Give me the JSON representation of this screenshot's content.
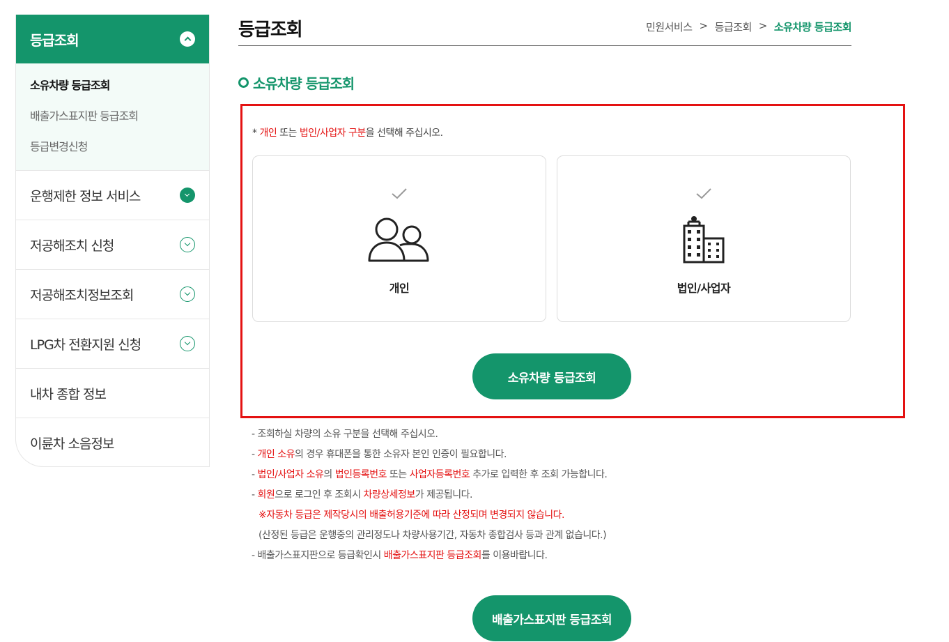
{
  "sidebar": {
    "header": "등급조회",
    "subitems": [
      "소유차량 등급조회",
      "배출가스표지판 등급조회",
      "등급변경신청"
    ],
    "items": [
      "운행제한 정보 서비스",
      "저공해조치 신청",
      "저공해조치정보조회",
      "LPG차 전환지원 신청",
      "내차 종합 정보",
      "이륜차 소음정보"
    ]
  },
  "page": {
    "title": "등급조회",
    "breadcrumb": [
      "민원서비스",
      ">",
      "등급조회",
      ">",
      "소유차량 등급조회"
    ]
  },
  "section": {
    "title": "소유차량 등급조회",
    "notice": {
      "star": "* ",
      "opt1": "개인",
      "mid": " 또는 ",
      "opt2": "법인/사업자 구분",
      "tail": "을 선택해 주십시오."
    },
    "cards": {
      "individual": "개인",
      "corporate": "법인/사업자"
    },
    "search_button": "소유차량 등급조회"
  },
  "notes": {
    "l1": "- 조회하실 차량의 소유 구분을 선택해 주십시오.",
    "l2": {
      "dash": "- ",
      "r1": "개인 소유",
      "t1": "의 경우 휴대폰을 통한 소유자 본인 인증이 필요합니다."
    },
    "l3": {
      "dash": "- ",
      "r1": "법인/사업자 소유",
      "t1": "의 ",
      "r2": "법인등록번호",
      "t2": " 또는 ",
      "r3": "사업자등록번호",
      "t3": " 추가로 입력한 후 조회 가능합니다."
    },
    "l4": {
      "dash": "- ",
      "r1": "회원",
      "t1": "으로 로그인 후 조회시 ",
      "r2": "차량상세정보",
      "t2": "가 제공됩니다."
    },
    "l5": "※자동차 등급은 제작당시의 배출허용기준에 따라 산정되며 변경되지 않습니다.",
    "l6": "(산정된 등급은 운행중의 관리정도나 차량사용기간, 자동차 종합검사 등과 관계 없습니다.)",
    "l7": {
      "t0": "- 배출가스표지판으로 등급확인시 ",
      "r1": "배출가스표지판 등급조회",
      "t1": "를 이용바랍니다."
    }
  },
  "bottom_button": "배출가스표지판 등급조회",
  "colors": {
    "accent": "#14956b",
    "highlight_red": "#e41212"
  }
}
